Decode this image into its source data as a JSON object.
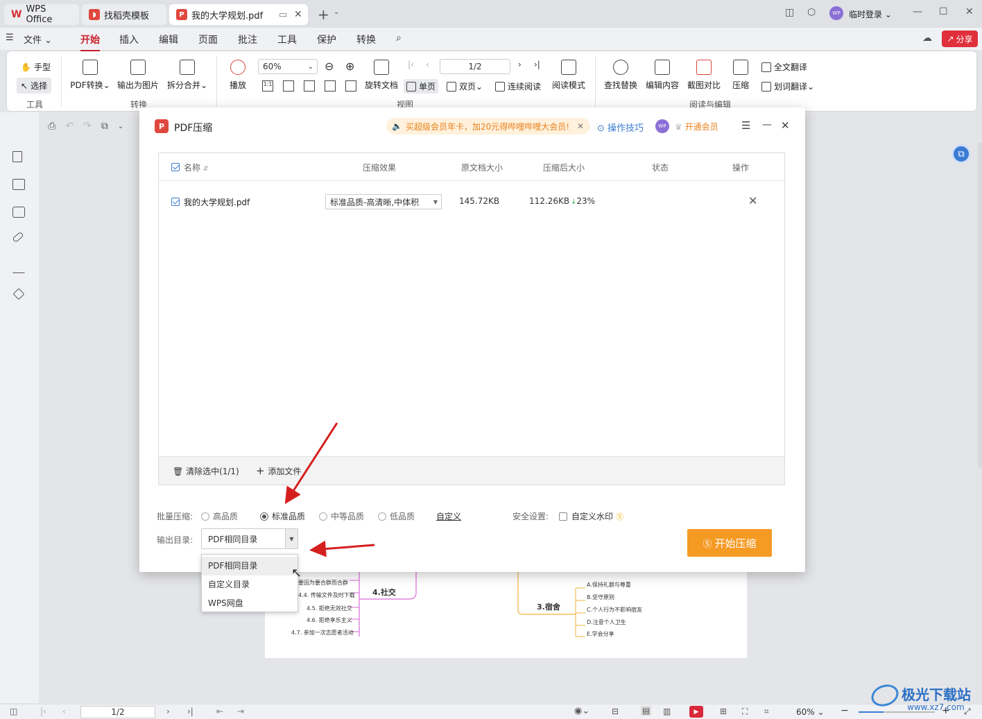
{
  "tabs": [
    {
      "label": "WPS Office"
    },
    {
      "label": "找稻壳模板"
    },
    {
      "label": "我的大学规划.pdf"
    }
  ],
  "titlebar": {
    "login": "临时登录",
    "avatar_text": "WP"
  },
  "menu": {
    "file": "文件",
    "items": [
      "开始",
      "插入",
      "编辑",
      "页面",
      "批注",
      "工具",
      "保护",
      "转换"
    ],
    "share": "分享"
  },
  "ribbon": {
    "hand": "手型",
    "select": "选择",
    "group_tools": "工具",
    "pdf_convert": "PDF转换",
    "to_image": "输出为图片",
    "split_merge": "拆分合并",
    "group_convert": "转换",
    "play": "播放",
    "zoom": "60%",
    "page": "1/2",
    "rotate": "旋转文档",
    "single": "单页",
    "double": "双页",
    "continuous": "连续阅读",
    "read_mode": "阅读模式",
    "group_view": "视图",
    "find": "查找替换",
    "edit_content": "编辑内容",
    "compare": "截图对比",
    "compress": "压缩",
    "full_translate": "全文翻译",
    "word_translate": "划词翻译",
    "group_read": "阅读与编辑"
  },
  "dialog": {
    "title": "PDF压缩",
    "promo": "买超级会员年卡，加20元得哔哩哔哩大会员!",
    "tips": "操作技巧",
    "avatar": "WP",
    "vip": "开通会员",
    "columns": {
      "name": "名称",
      "effect": "压缩效果",
      "orig": "原文档大小",
      "after": "压缩后大小",
      "status": "状态",
      "action": "操作"
    },
    "files": [
      {
        "name": "我的大学规划.pdf",
        "effect": "标准品质-高清晰,中体积",
        "orig": "145.72KB",
        "after": "112.26KB",
        "delta": "23%"
      }
    ],
    "clear": "清除选中(1/1)",
    "add": "添加文件",
    "batch_label": "批量压缩:",
    "quality": [
      {
        "label": "高品质",
        "selected": false
      },
      {
        "label": "标准品质",
        "selected": true
      },
      {
        "label": "中等品质",
        "selected": false
      },
      {
        "label": "低品质",
        "selected": false
      }
    ],
    "custom": "自定义",
    "security_label": "安全设置:",
    "watermark": "自定义水印",
    "output_label": "输出目录:",
    "output_value": "PDF相同目录",
    "start": "开始压缩",
    "options": [
      "PDF相同目录",
      "自定义目录",
      "WPS网盘"
    ]
  },
  "mindmap": {
    "left_branch": "4.社交",
    "left_items": [
      "要因为要合群而合群",
      "4.4. 传输文件及时下载",
      "4.5. 拒绝无效社交",
      "4.6. 拒绝享乐主义",
      "4.7. 参加一次志愿者活动"
    ],
    "right_branch": "3.宿舍",
    "right_items": [
      "A.保持礼貌与尊重",
      "B.坚守原则",
      "C.个人行为不影响宿友",
      "D.注意个人卫生",
      "E.学会分享"
    ]
  },
  "statusbar": {
    "page": "1/2",
    "zoom": "60%"
  },
  "watermark": {
    "brand": "极光下载站",
    "url": "www.xz7.com"
  },
  "colors": {
    "accent": "#c8202a",
    "orange": "#f59a23",
    "blue": "#3b7bd4"
  }
}
